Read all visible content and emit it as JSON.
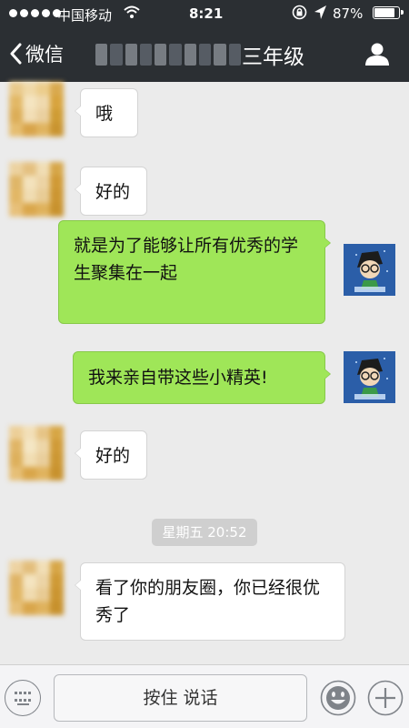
{
  "status_bar": {
    "carrier": "中国移动",
    "time": "8:21",
    "battery_percent": "87%",
    "battery_level": 0.87,
    "signal_bars": 5
  },
  "nav": {
    "back_label": "微信",
    "title": "三年级",
    "profile_icon": "person-icon"
  },
  "messages": [
    {
      "side": "in",
      "text": "哦"
    },
    {
      "side": "in",
      "text": "好的"
    },
    {
      "side": "out",
      "text": "就是为了能够让所有优秀的学生聚集在一起"
    },
    {
      "side": "out",
      "text": "我来亲自带这些小精英!"
    },
    {
      "side": "in",
      "text": "好的"
    },
    {
      "side": "in",
      "text": "看了你的朋友圈，你已经很优秀了"
    }
  ],
  "time_tag": "星期五 20:52",
  "input_bar": {
    "hold_to_talk_label": "按住 说话",
    "keyboard_icon": "keyboard-icon",
    "emoji_icon": "emoji-icon",
    "plus_icon": "plus-icon"
  },
  "colors": {
    "nav_bg": "#2b2f33",
    "chat_bg": "#ebebeb",
    "outgoing_bubble": "#9fe658",
    "incoming_bubble": "#ffffff"
  }
}
